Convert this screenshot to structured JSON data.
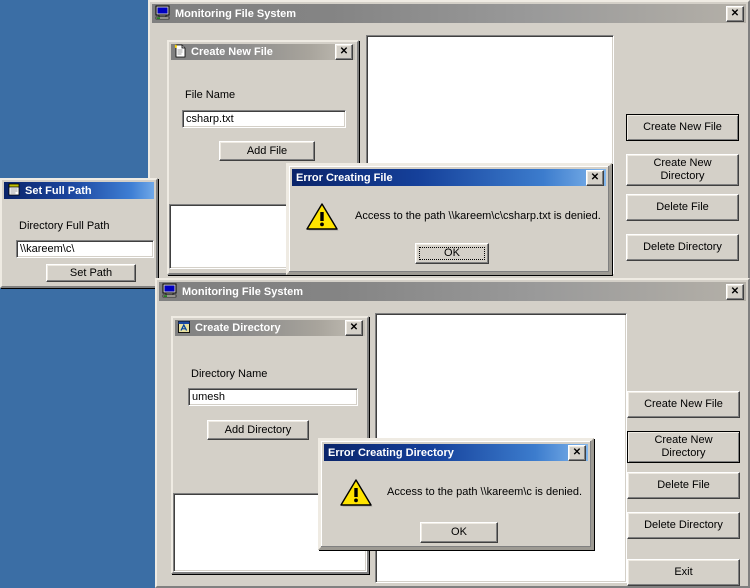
{
  "desktop": {
    "background": "#3b6ea5"
  },
  "windows": {
    "monitor1": {
      "title": "Monitoring File System",
      "icon": "computer-icon",
      "close_label": "✕",
      "buttons": [
        {
          "label": "Create New File",
          "default": true
        },
        {
          "label": "Create New\nDirectory",
          "default": false
        },
        {
          "label": "Delete File",
          "default": false
        },
        {
          "label": "Delete Directory",
          "default": false
        }
      ]
    },
    "monitor2": {
      "title": "Monitoring File System",
      "icon": "computer-icon",
      "close_label": "✕",
      "buttons": [
        {
          "label": "Create New File",
          "default": false
        },
        {
          "label": "Create New\nDirectory",
          "default": true
        },
        {
          "label": "Delete File",
          "default": false
        },
        {
          "label": "Delete Directory",
          "default": false
        },
        {
          "label": "Exit",
          "default": false
        }
      ]
    },
    "create_new_file": {
      "title": "Create New File",
      "icon": "new-document-icon",
      "close_label": "✕",
      "field_label": "File Name",
      "field_value": "csharp.txt",
      "button_label": "Add File"
    },
    "create_directory": {
      "title": "Create Directory",
      "icon": "folder-window-icon",
      "close_label": "✕",
      "field_label": "Directory Name",
      "field_value": "umesh",
      "button_label": "Add Directory"
    },
    "set_full_path": {
      "title": "Set Full Path",
      "icon": "path-icon",
      "field_label": "Directory Full Path",
      "field_value": "\\\\kareem\\c\\",
      "button_label": "Set Path"
    },
    "error_file": {
      "title": "Error Creating File",
      "icon": "warning-icon",
      "close_label": "✕",
      "message": "Access to the path \\\\kareem\\c\\csharp.txt is denied.",
      "ok_label": "OK",
      "ok_focused": true
    },
    "error_directory": {
      "title": "Error Creating Directory",
      "icon": "warning-icon",
      "close_label": "✕",
      "message": "Access to the path \\\\kareem\\c is denied.",
      "ok_label": "OK",
      "ok_focused": false
    }
  },
  "colors": {
    "desktop": "#3b6ea5",
    "face": "#d4d0c8",
    "caption_active_start": "#0a246a",
    "caption_active_end": "#82b6ec",
    "caption_inactive_start": "#808080",
    "caption_inactive_end": "#b4b0a8",
    "warning_yellow": "#ffe400"
  }
}
